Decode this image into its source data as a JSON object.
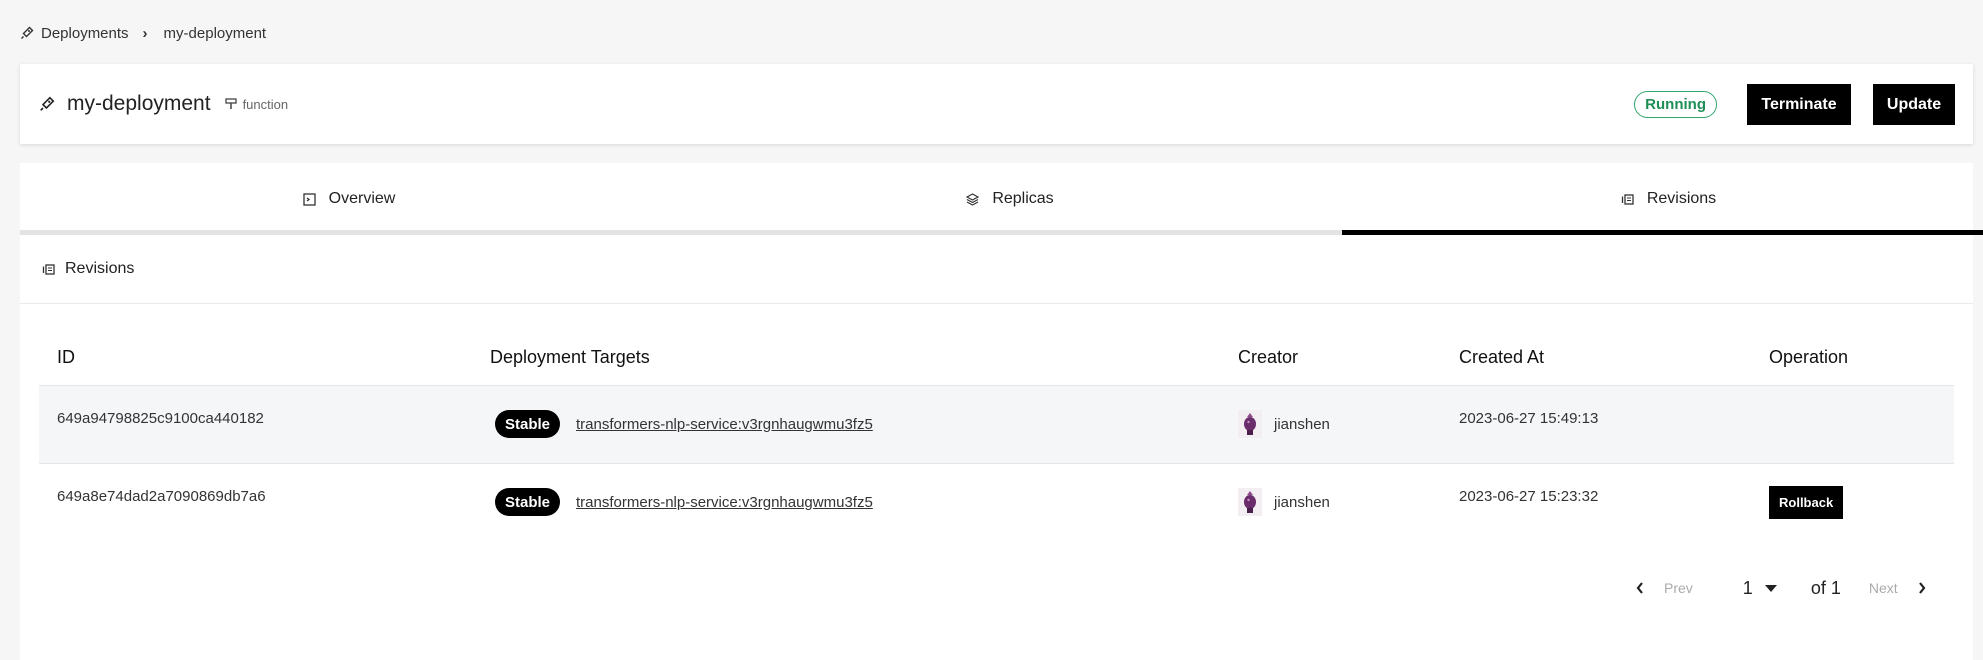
{
  "breadcrumb": {
    "parent": "Deployments",
    "current": "my-deployment"
  },
  "header": {
    "title": "my-deployment",
    "kind": "function",
    "status": "Running",
    "terminate_label": "Terminate",
    "update_label": "Update"
  },
  "tabs": [
    {
      "label": "Overview"
    },
    {
      "label": "Replicas"
    },
    {
      "label": "Revisions"
    }
  ],
  "section": {
    "title": "Revisions"
  },
  "table": {
    "columns": [
      "ID",
      "Deployment Targets",
      "Creator",
      "Created At",
      "Operation"
    ],
    "rows": [
      {
        "id": "649a94798825c9100ca440182",
        "badge": "Stable",
        "target": "transformers-nlp-service:v3rgnhaugwmu3fz5",
        "creator": "jianshen",
        "created_at": "2023-06-27 15:49:13",
        "operation": ""
      },
      {
        "id": "649a8e74dad2a7090869db7a6",
        "badge": "Stable",
        "target": "transformers-nlp-service:v3rgnhaugwmu3fz5",
        "creator": "jianshen",
        "created_at": "2023-06-27 15:23:32",
        "operation": "Rollback"
      }
    ]
  },
  "pagination": {
    "prev_label": "Prev",
    "page": "1",
    "of_label": "of 1",
    "next_label": "Next"
  },
  "colors": {
    "accent": "#000000",
    "status_green": "#2ea56a",
    "row_highlight": "#f5f6f8"
  },
  "icons": {
    "breadcrumb": "rocket-icon",
    "title": "rocket-icon",
    "kind": "function-icon",
    "overview_tab": "overview-icon",
    "replicas_tab": "layers-icon",
    "revisions_tab": "history-icon",
    "avatar": "avatar-icon"
  }
}
